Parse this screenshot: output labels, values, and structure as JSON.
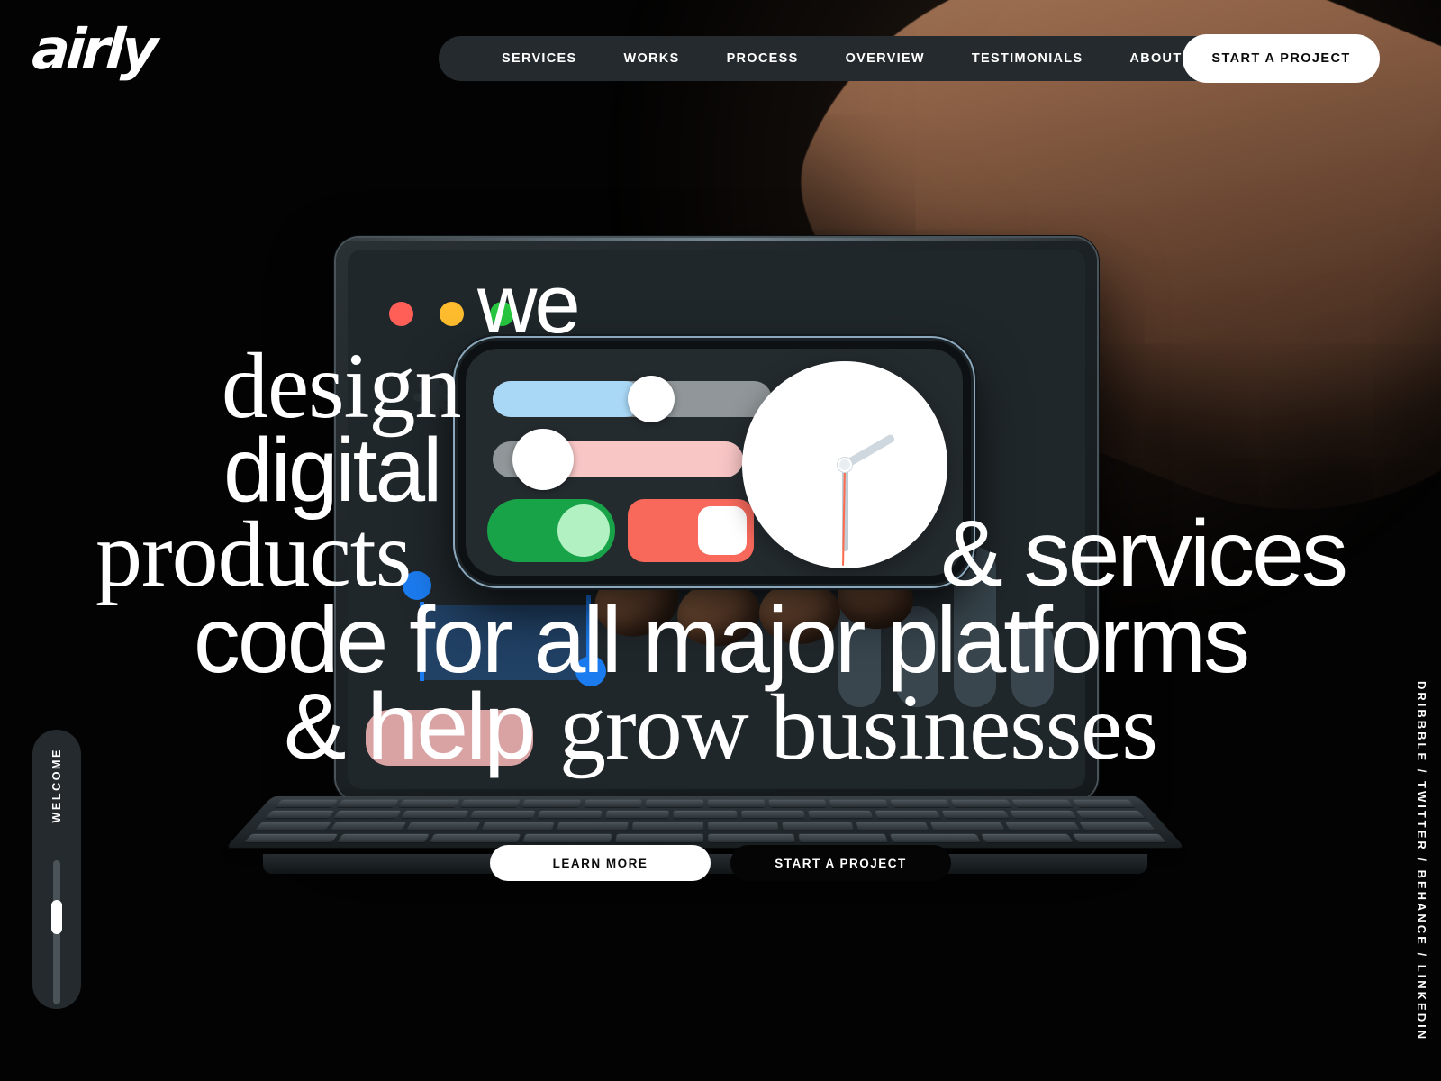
{
  "brand": {
    "logo": "airly"
  },
  "nav": {
    "items": [
      {
        "label": "SERVICES"
      },
      {
        "label": "WORKS"
      },
      {
        "label": "PROCESS"
      },
      {
        "label": "OVERVIEW"
      },
      {
        "label": "TESTIMONIALS"
      },
      {
        "label": "ABOUT US"
      }
    ],
    "cta_label": "START A PROJECT"
  },
  "hero": {
    "line1": "we",
    "line2": "design",
    "line3": "digital",
    "line4_left": "products",
    "line4_right": "& services",
    "line5": "code for all major platforms",
    "line6_sans": "& help",
    "line6_serif": "grow businesses"
  },
  "cta": {
    "learn_more": "LEARN MORE",
    "start_project": "START A PROJECT"
  },
  "rail": {
    "welcome": "WELCOME"
  },
  "social": {
    "links": "DRIBBBLE / TWITTER / BEHANCE / LINKEDIN"
  },
  "device": {
    "window_dots": [
      {
        "name": "close-dot",
        "color": "#FF5F57"
      },
      {
        "name": "minimize-dot",
        "color": "#FEBC2E"
      },
      {
        "name": "maximize-dot",
        "color": "#28C840"
      }
    ],
    "phone_ui": {
      "slider_top": {
        "track": "#909699",
        "fill": "#A9D8F7",
        "fill_pct": 54
      },
      "slider_bottom": {
        "track": "#909699",
        "fill": "#F9C6C6",
        "fill_pct": 92
      },
      "toggle_green": {
        "bg": "#18A349",
        "knob": "#B2F2C2"
      },
      "toggle_red": {
        "bg": "#F8695C",
        "knob": "#FFFFFF"
      },
      "clock": {
        "face": "#FFFFFF",
        "hour_deg": 60,
        "minute_deg": 180,
        "second_deg": 181
      }
    }
  },
  "theme": {
    "background": "#030303",
    "nav_pill": "#242a2d",
    "accent_blue": "#1b7cf0",
    "accent_pink": "#FABABA",
    "text": "#FFFFFF"
  }
}
